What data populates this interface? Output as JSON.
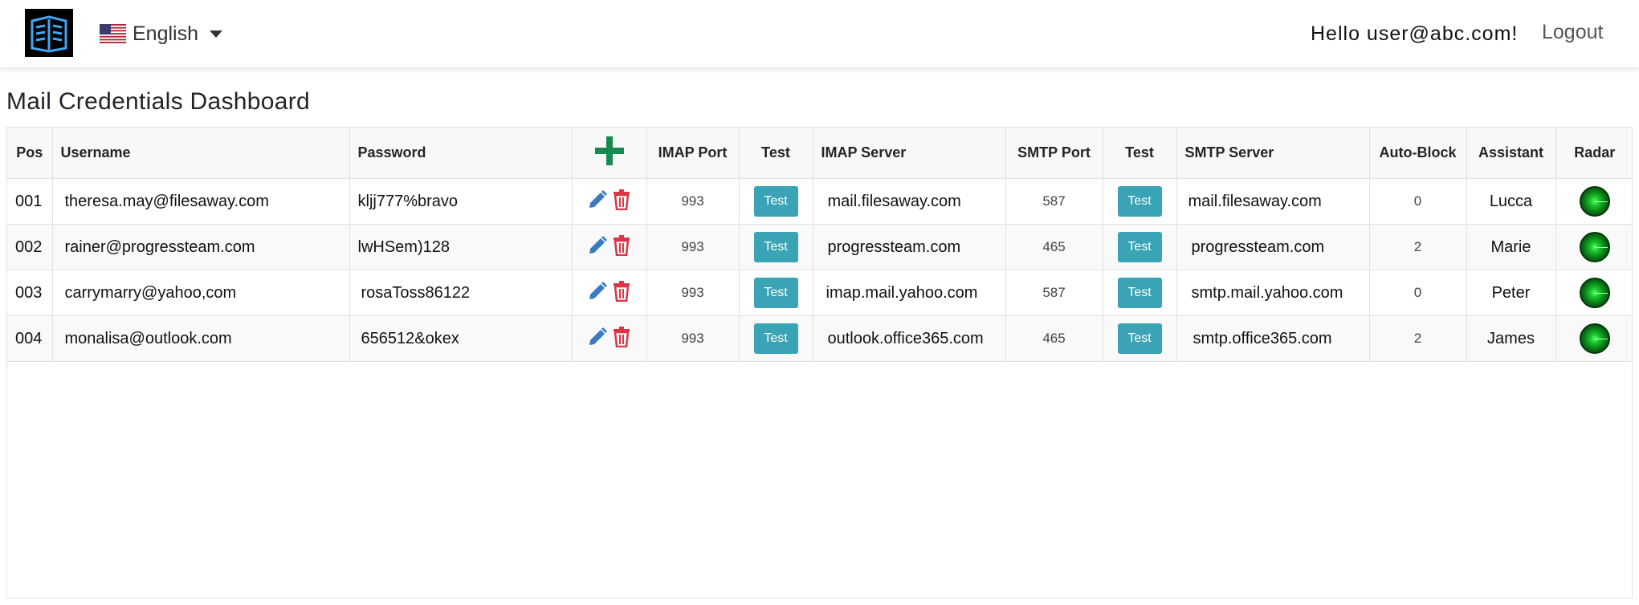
{
  "header": {
    "language": "English",
    "greeting": "Hello user@abc.com!",
    "logout": "Logout"
  },
  "page": {
    "title": "Mail Credentials Dashboard"
  },
  "table": {
    "columns": {
      "pos": "Pos",
      "username": "Username",
      "password": "Password",
      "imap_port": "IMAP Port",
      "imap_test": "Test",
      "imap_server": "IMAP Server",
      "smtp_port": "SMTP Port",
      "smtp_test": "Test",
      "smtp_server": "SMTP Server",
      "auto_block": "Auto-Block",
      "assistant": "Assistant",
      "radar": "Radar"
    },
    "test_label": "Test",
    "rows": [
      {
        "pos": "001",
        "username": "theresa.may@filesaway.com",
        "password": "kljj777%bravo",
        "imap_port": "993",
        "imap_server": "mail.filesaway.com",
        "smtp_port": "587",
        "smtp_server": "mail.filesaway.com",
        "auto_block": "0",
        "assistant": "Lucca"
      },
      {
        "pos": "002",
        "username": "rainer@progressteam.com",
        "password": "lwHSem)128",
        "imap_port": "993",
        "imap_server": "progressteam.com",
        "smtp_port": "465",
        "smtp_server": "progressteam.com",
        "auto_block": "2",
        "assistant": "Marie"
      },
      {
        "pos": "003",
        "username": "carrymarry@yahoo,com",
        "password": "rosaToss86122",
        "imap_port": "993",
        "imap_server": "imap.mail.yahoo.com",
        "smtp_port": "587",
        "smtp_server": "smtp.mail.yahoo.com",
        "auto_block": "0",
        "assistant": "Peter"
      },
      {
        "pos": "004",
        "username": "monalisa@outlook.com",
        "password": "656512&okex",
        "imap_port": "993",
        "imap_server": "outlook.office365.com",
        "smtp_port": "465",
        "smtp_server": "smtp.office365.com",
        "auto_block": "2",
        "assistant": "James"
      }
    ]
  },
  "colors": {
    "add_icon": "#178a50",
    "edit_icon": "#3a7bbf",
    "delete_icon": "#dc3545",
    "test_button": "#3aa3b5",
    "radar": "#18c12a"
  },
  "icons": {
    "logo": "book-logo-icon",
    "flag": "us-flag-icon",
    "add": "plus-icon",
    "edit": "pencil-icon",
    "delete": "trash-icon",
    "radar": "radar-icon"
  }
}
